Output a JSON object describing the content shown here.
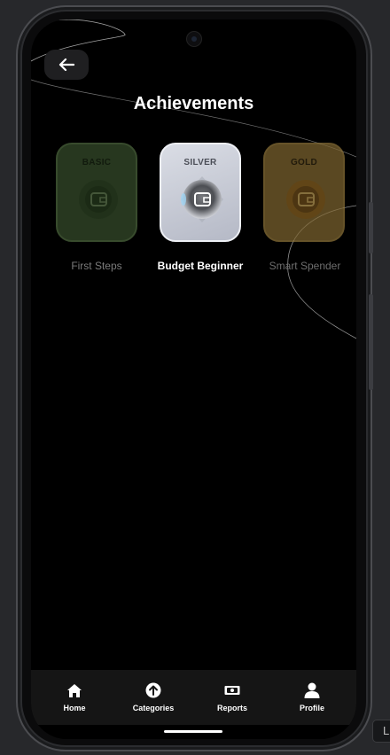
{
  "screen": {
    "title": "Achievements"
  },
  "back_button": {
    "icon": "arrow-left-icon"
  },
  "badges": [
    {
      "tier": "BASIC",
      "name": "First Steps",
      "icon": "wallet-icon",
      "state": "locked",
      "color": "#4f6b3f"
    },
    {
      "tier": "SILVER",
      "name": "Budget Beginner",
      "icon": "wallet-icon",
      "state": "unlocked",
      "color": "#c7cbd6"
    },
    {
      "tier": "GOLD",
      "name": "Smart Spender",
      "icon": "wallet-icon",
      "state": "locked",
      "color": "#8a6e34"
    }
  ],
  "navbar": {
    "items": [
      {
        "label": "Home",
        "icon": "home-icon"
      },
      {
        "label": "Categories",
        "icon": "upload-circle-icon"
      },
      {
        "label": "Reports",
        "icon": "money-icon"
      },
      {
        "label": "Profile",
        "icon": "person-icon"
      }
    ]
  },
  "overlay_tag": {
    "text": "L"
  },
  "colors": {
    "background": "#000000",
    "navbar": "#151515",
    "accent_text": "#ffffff"
  }
}
